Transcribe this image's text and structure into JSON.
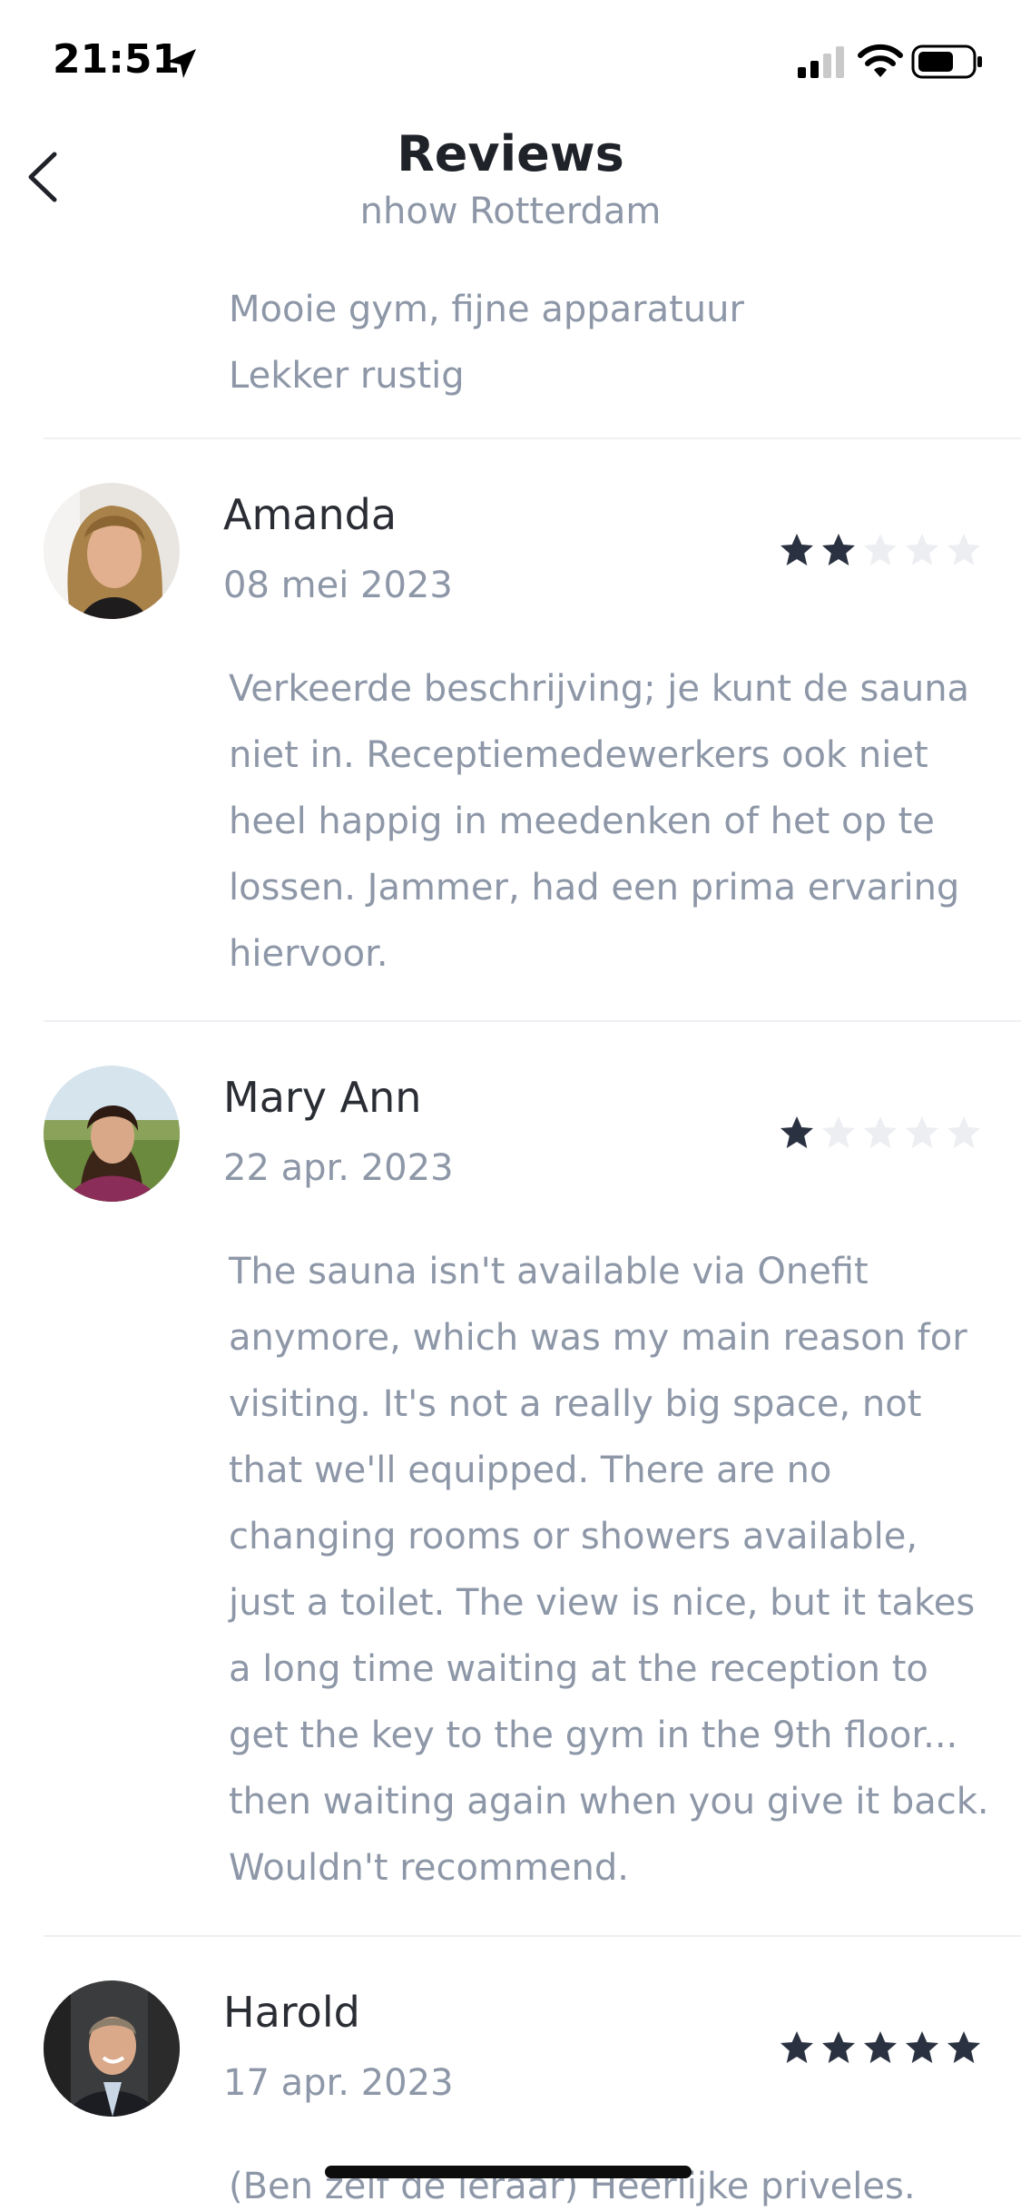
{
  "status_bar": {
    "time": "21:51",
    "icons": [
      "location-arrow-icon",
      "signal-icon",
      "wifi-icon",
      "battery-icon"
    ]
  },
  "header": {
    "title": "Reviews",
    "subtitle": "nhow Rotterdam",
    "back_icon": "chevron-left-icon"
  },
  "previous_review": {
    "lines": [
      "Mooie gym, fijne apparatuur",
      "Lekker rustig"
    ]
  },
  "reviews": [
    {
      "name": "Amanda",
      "date": "08 mei 2023",
      "rating": 2,
      "max_rating": 5,
      "text": "Verkeerde beschrijving; je kunt de sauna niet in. Receptiemedewerkers ook niet heel happig in meedenken of het op te lossen. Jammer, had een prima ervaring hiervoor."
    },
    {
      "name": "Mary Ann",
      "date": "22 apr. 2023",
      "rating": 1,
      "max_rating": 5,
      "text": "The sauna isn't available via Onefit anymore, which was my main reason for visiting. It's not a really big space, not that we'll equipped. There are no changing rooms or showers available, just a toilet. The view is nice, but it takes a long time waiting at the reception to get the key to the gym in the 9th floor... then waiting again when you give it back. Wouldn't recommend."
    },
    {
      "name": "Harold",
      "date": "17 apr. 2023",
      "rating": 5,
      "max_rating": 5,
      "text": "(Ben zelf de leraar) Heerlijke priveles."
    }
  ],
  "colors": {
    "star_filled": "#2a3140",
    "star_empty": "#eceef1",
    "text_primary": "#2a2d34",
    "text_secondary": "#8d97a7",
    "divider": "#eef0f3"
  }
}
